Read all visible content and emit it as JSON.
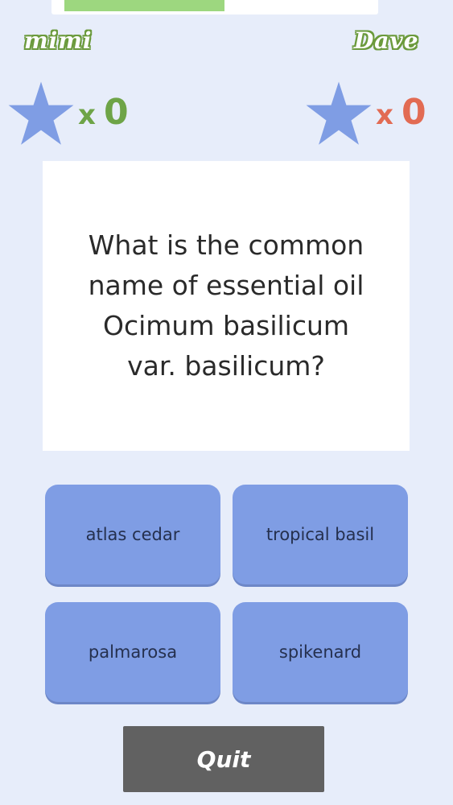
{
  "timer": {
    "remaining_fraction": 0.51
  },
  "players": {
    "left": {
      "name": "mimi",
      "times": "x",
      "score": "0",
      "color": "#6ea447"
    },
    "right": {
      "name": "Dave",
      "times": "x",
      "score": "0",
      "color": "#e26b53"
    }
  },
  "star_color": "#7f9de4",
  "question": {
    "text": "What is the common name of essential oil Ocimum basilicum var. basilicum?"
  },
  "answers": [
    {
      "label": "atlas cedar"
    },
    {
      "label": "tropical basil"
    },
    {
      "label": "palmarosa"
    },
    {
      "label": "spikenard"
    }
  ],
  "quit_label": "Quit"
}
